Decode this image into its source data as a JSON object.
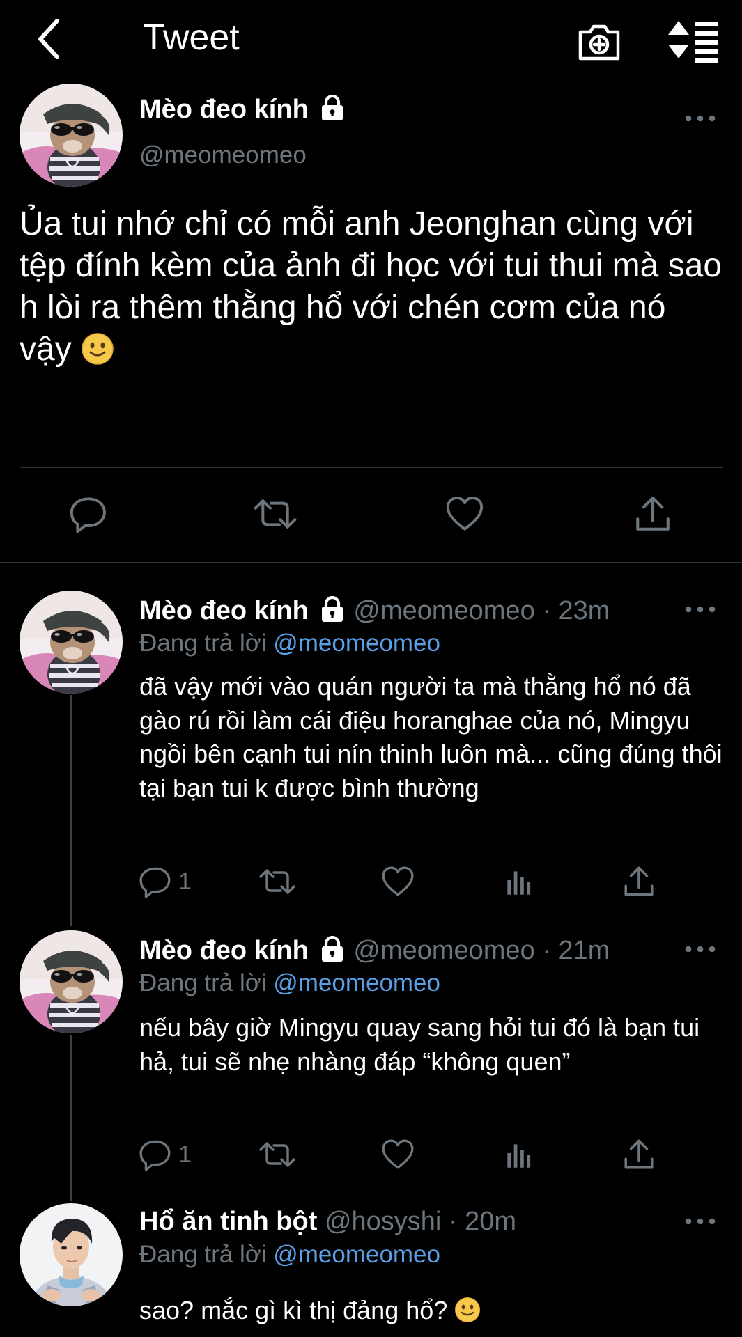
{
  "header": {
    "title": "Tweet"
  },
  "main_tweet": {
    "name": "Mèo đeo kính",
    "handle": "@meomeomeo",
    "text": "Ủa tui nhớ chỉ có mỗi anh Jeonghan cùng với tệp đính kèm của ảnh đi học với tui thui mà sao h lòi ra thêm thằng hổ với chén cơm của nó vậy",
    "text_emoji": "slightly-smiling-face"
  },
  "replies": [
    {
      "name": "Mèo đeo kính",
      "handle": "@meomeomeo",
      "time": "23m",
      "replying_label": "Đang trả lời",
      "mention": "@meomeomeo",
      "text": "đã vậy mới vào quán người ta mà thằng hổ nó đã gào rú rồi làm cái điệu horanghae của nó, Mingyu ngồi bên cạnh tui nín thinh luôn mà... cũng đúng thôi tại bạn tui k được bình thường",
      "reply_count": "1"
    },
    {
      "name": "Mèo đeo kính",
      "handle": "@meomeomeo",
      "time": "21m",
      "replying_label": "Đang trả lời",
      "mention": "@meomeomeo",
      "text": "nếu bây giờ Mingyu quay sang hỏi tui đó là bạn tui hả, tui sẽ nhẹ nhàng đáp “không quen”",
      "reply_count": "1"
    },
    {
      "name": "Hổ ăn tinh bột",
      "handle": "@hosyshi",
      "time": "20m",
      "replying_label": "Đang trả lời",
      "mention": "@meomeomeo",
      "text": "sao? mắc gì kì thị đảng hổ?",
      "text_emoji": "slightly-smiling-face"
    }
  ],
  "separator": " · ",
  "colors": {
    "background": "#000000",
    "secondary_text": "#6e767d",
    "mention": "#5a9fe6",
    "divider": "#2f3336"
  }
}
